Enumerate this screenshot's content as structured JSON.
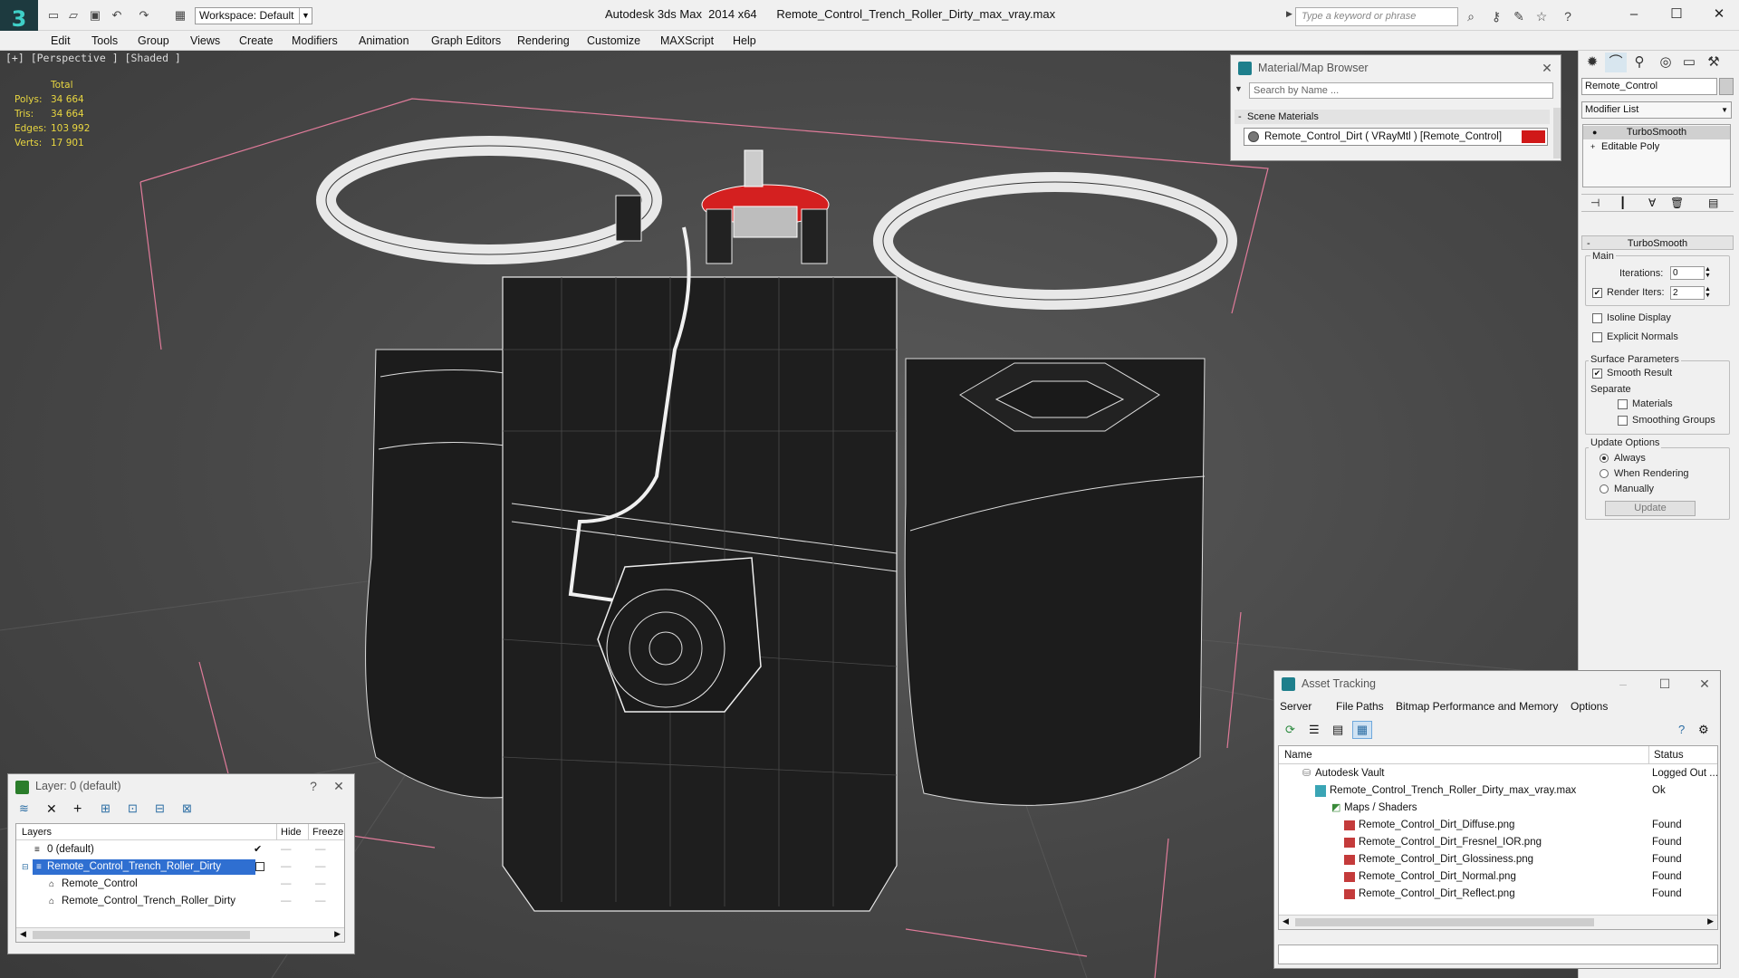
{
  "app": {
    "logo": "3",
    "workspace": "Workspace: Default",
    "title": "Autodesk 3ds Max  2014 x64      Remote_Control_Trench_Roller_Dirty_max_vray.max",
    "keyword_placeholder": "Type a keyword or phrase"
  },
  "menu": [
    "Edit",
    "Tools",
    "Group",
    "Views",
    "Create",
    "Modifiers",
    "Animation",
    "Graph Editors",
    "Rendering",
    "Customize",
    "MAXScript",
    "Help"
  ],
  "viewport": {
    "label": "[+] [Perspective ] [Shaded ]",
    "stats": {
      "header": "Total",
      "rows": [
        {
          "label": "Polys:",
          "value": "34 664"
        },
        {
          "label": "Tris:",
          "value": "34 664"
        },
        {
          "label": "Edges:",
          "value": "103 992"
        },
        {
          "label": "Verts:",
          "value": "17 901"
        }
      ]
    }
  },
  "material_browser": {
    "title": "Material/Map Browser",
    "search_placeholder": "Search by Name ...",
    "section": "Scene Materials",
    "item": "Remote_Control_Dirt  ( VRayMtl )  [Remote_Control]",
    "swatch_color": "#d01818"
  },
  "command_panel": {
    "object_name": "Remote_Control",
    "modifier_list": "Modifier List",
    "stack": [
      "TurboSmooth",
      "Editable Poly"
    ],
    "rollout": "TurboSmooth",
    "main_group": "Main",
    "iterations_label": "Iterations:",
    "iterations_value": "0",
    "render_iters_label": "Render Iters:",
    "render_iters_value": "2",
    "isoline": "Isoline Display",
    "explicit": "Explicit Normals",
    "surface_group": "Surface Parameters",
    "smooth_result": "Smooth Result",
    "separate": "Separate",
    "materials": "Materials",
    "smoothing_groups": "Smoothing Groups",
    "update_group": "Update Options",
    "always": "Always",
    "when_rendering": "When Rendering",
    "manually": "Manually",
    "update_btn": "Update"
  },
  "layer_panel": {
    "title": "Layer: 0 (default)",
    "help": "?",
    "col_layers": "Layers",
    "col_hide": "Hide",
    "col_freeze": "Freeze",
    "rows": [
      {
        "name": "0 (default)"
      },
      {
        "name": "Remote_Control_Trench_Roller_Dirty"
      },
      {
        "name": "Remote_Control"
      },
      {
        "name": "Remote_Control_Trench_Roller_Dirty"
      }
    ]
  },
  "asset_tracking": {
    "title": "Asset Tracking",
    "menu": [
      "Server",
      "File",
      "Paths",
      "Bitmap Performance and Memory",
      "Options"
    ],
    "col_name": "Name",
    "col_status": "Status",
    "rows": [
      {
        "name": "Autodesk Vault",
        "status": "Logged Out ..."
      },
      {
        "name": "Remote_Control_Trench_Roller_Dirty_max_vray.max",
        "status": "Ok"
      },
      {
        "name": "Maps / Shaders",
        "status": ""
      },
      {
        "name": "Remote_Control_Dirt_Diffuse.png",
        "status": "Found"
      },
      {
        "name": "Remote_Control_Dirt_Fresnel_IOR.png",
        "status": "Found"
      },
      {
        "name": "Remote_Control_Dirt_Glossiness.png",
        "status": "Found"
      },
      {
        "name": "Remote_Control_Dirt_Normal.png",
        "status": "Found"
      },
      {
        "name": "Remote_Control_Dirt_Reflect.png",
        "status": "Found"
      }
    ]
  }
}
